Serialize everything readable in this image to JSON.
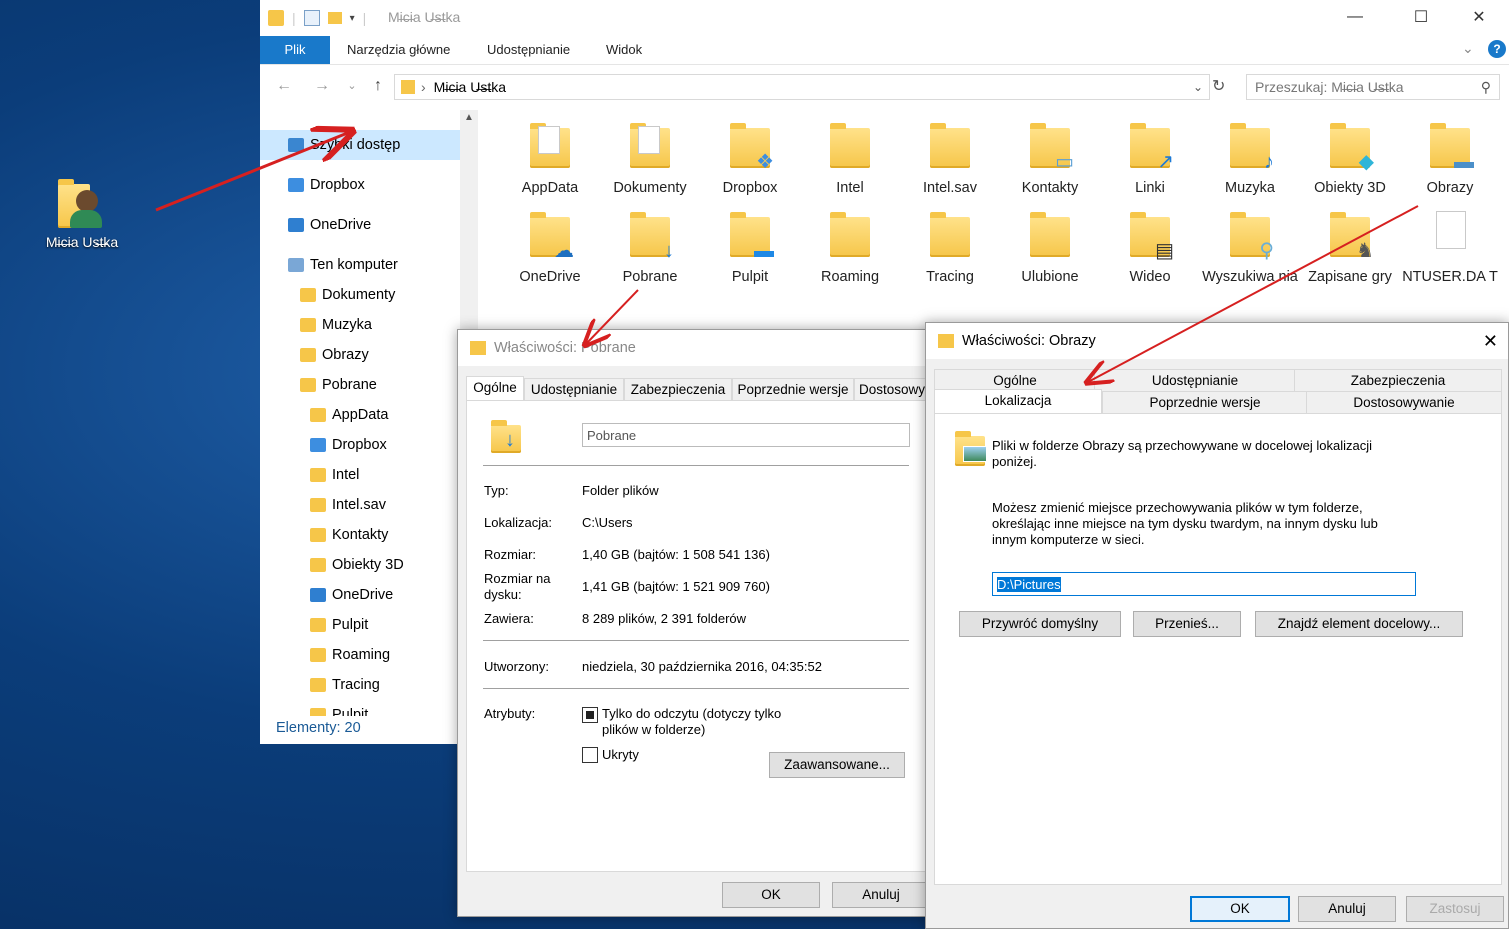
{
  "desktop": {
    "user_icon_label": "Mi̶c̶ia Us̶t̶ka"
  },
  "explorer": {
    "title": "Mi̶c̶ia U̶s̶tka",
    "ribbon_tabs": [
      "Plik",
      "Narzędzia główne",
      "Udostępnianie",
      "Widok"
    ],
    "address": "Mi̶c̶ia U̶s̶tka",
    "search_placeholder": "Przeszukaj: Mi̶c̶ia U̶s̶tka",
    "nav_items": [
      {
        "label": "Szybki dostęp",
        "icon": "star-icon",
        "indent": 0
      },
      {
        "label": "Dropbox",
        "icon": "dropbox-icon",
        "indent": 0
      },
      {
        "label": "OneDrive",
        "icon": "onedrive-icon",
        "indent": 0
      },
      {
        "label": "Ten komputer",
        "icon": "computer-icon",
        "indent": 0
      },
      {
        "label": "Dokumenty",
        "icon": "documents-icon",
        "indent": 1
      },
      {
        "label": "Muzyka",
        "icon": "music-icon",
        "indent": 1
      },
      {
        "label": "Obrazy",
        "icon": "pictures-icon",
        "indent": 1
      },
      {
        "label": "Pobrane",
        "icon": "downloads-icon",
        "indent": 1
      },
      {
        "label": "AppData",
        "icon": "folder-icon",
        "indent": 2
      },
      {
        "label": "Dropbox",
        "icon": "dropbox-folder-icon",
        "indent": 2
      },
      {
        "label": "Intel",
        "icon": "folder-icon",
        "indent": 2
      },
      {
        "label": "Intel.sav",
        "icon": "folder-icon",
        "indent": 2
      },
      {
        "label": "Kontakty",
        "icon": "contacts-icon",
        "indent": 2
      },
      {
        "label": "Obiekty 3D",
        "icon": "objects3d-icon",
        "indent": 2
      },
      {
        "label": "OneDrive",
        "icon": "onedrive-folder-icon",
        "indent": 2
      },
      {
        "label": "Pulpit",
        "icon": "desktop-folder-icon",
        "indent": 2
      },
      {
        "label": "Roaming",
        "icon": "folder-icon",
        "indent": 2
      },
      {
        "label": "Tracing",
        "icon": "folder-icon",
        "indent": 2
      },
      {
        "label": "Pulpit",
        "icon": "desktop-folder-icon",
        "indent": 2
      }
    ],
    "status": "Elementy: 20",
    "files_row1": [
      {
        "label": "AppData",
        "icon": "folder-doc-icon"
      },
      {
        "label": "Dokumenty",
        "icon": "documents-folder-icon"
      },
      {
        "label": "Dropbox",
        "icon": "dropbox-folder-icon"
      },
      {
        "label": "Intel",
        "icon": "folder-icon"
      },
      {
        "label": "Intel.sav",
        "icon": "folder-icon"
      },
      {
        "label": "Kontakty",
        "icon": "contacts-folder-icon"
      },
      {
        "label": "Linki",
        "icon": "links-folder-icon"
      },
      {
        "label": "Muzyka",
        "icon": "music-folder-icon"
      },
      {
        "label": "Obiekty 3D",
        "icon": "objects3d-folder-icon"
      },
      {
        "label": "Obrazy",
        "icon": "pictures-folder-icon"
      }
    ],
    "files_row2": [
      {
        "label": "OneDrive",
        "icon": "onedrive-folder-icon"
      },
      {
        "label": "Pobrane",
        "icon": "downloads-folder-icon"
      },
      {
        "label": "Pulpit",
        "icon": "desktop-folder-icon"
      },
      {
        "label": "Roaming",
        "icon": "folder-icon"
      },
      {
        "label": "Tracing",
        "icon": "folder-icon"
      },
      {
        "label": "Ulubione",
        "icon": "favorites-folder-icon"
      },
      {
        "label": "Wideo",
        "icon": "video-folder-icon"
      },
      {
        "label": "Wyszukiwa nia",
        "icon": "searches-folder-icon"
      },
      {
        "label": "Zapisane gry",
        "icon": "games-folder-icon"
      },
      {
        "label": "NTUSER.DA T",
        "icon": "file-icon"
      }
    ]
  },
  "dlg_pobrane": {
    "title": "Właściwości: Pobrane",
    "tabs": [
      "Ogólne",
      "Udostępnianie",
      "Zabezpieczenia",
      "Poprzednie wersje",
      "Dostosowy"
    ],
    "name_value": "Pobrane",
    "rows": [
      {
        "label": "Typ:",
        "value": "Folder plików"
      },
      {
        "label": "Lokalizacja:",
        "value": "C:\\Users"
      },
      {
        "label": "Rozmiar:",
        "value": "1,40 GB (bajtów: 1 508 541 136)"
      },
      {
        "label": "Rozmiar na dysku:",
        "value": "1,41 GB (bajtów: 1 521 909 760)"
      },
      {
        "label": "Zawiera:",
        "value": "8 289 plików, 2 391 folderów"
      },
      {
        "label": "Utworzony:",
        "value": "niedziela, 30 października 2016, 04:35:52"
      }
    ],
    "attr_label": "Atrybuty:",
    "readonly_label": "Tylko do odczytu (dotyczy tylko plików w folderze)",
    "hidden_label": "Ukryty",
    "advanced_button": "Zaawansowane...",
    "ok": "OK",
    "cancel": "Anuluj"
  },
  "dlg_obrazy": {
    "title": "Właściwości: Obrazy",
    "tabs_row1": [
      "Ogólne",
      "Udostępnianie",
      "Zabezpieczenia"
    ],
    "tabs_row2": [
      "Lokalizacja",
      "Poprzednie wersje",
      "Dostosowywanie"
    ],
    "info": "Pliki w folderze Obrazy są przechowywane w docelowej lokalizacji poniżej.",
    "desc": "Możesz zmienić miejsce przechowywania plików w tym folderze, określając inne miejsce na tym dysku twardym, na innym dysku lub innym komputerze w sieci.",
    "path": "D:\\Pictures",
    "restore_button": "Przywróć domyślny",
    "move_button": "Przenieś...",
    "find_button": "Znajdź element docelowy...",
    "ok": "OK",
    "cancel": "Anuluj",
    "apply": "Zastosuj"
  },
  "colors": {
    "accent": "#1979ca",
    "arrow": "#d62020",
    "selection": "#cce8ff"
  }
}
